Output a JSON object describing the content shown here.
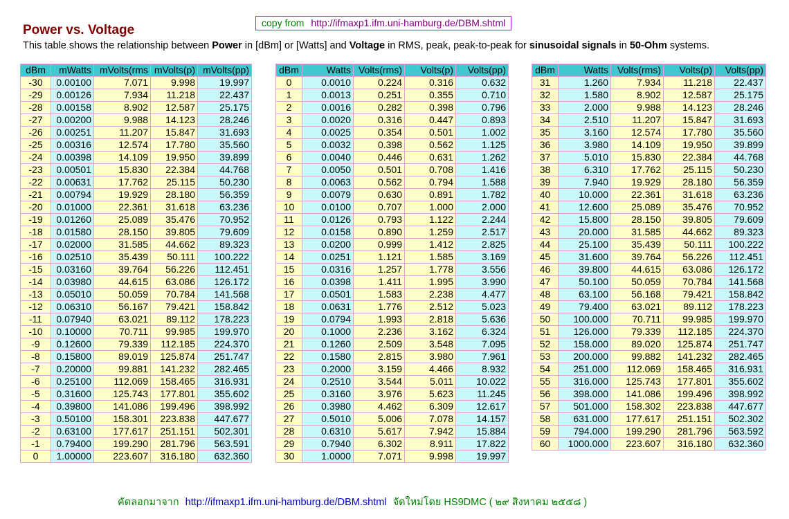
{
  "copy_box": {
    "label": "copy from",
    "url": "http://ifmaxp1.ifm.uni-hamburg.de/DBM.shtml"
  },
  "title": "Power vs. Voltage",
  "description": {
    "p1": "This table shows the relationship between ",
    "b1": "Power",
    "p2": " in [dBm] or [Watts] and ",
    "b2": "Voltage",
    "p3": " in RMS, peak, peak-to-peak for ",
    "b3": "sinusoidal signals",
    "p4": " in ",
    "b4": "50-Ohm",
    "p5": " systems."
  },
  "tables": [
    {
      "headers": [
        "dBm",
        "mWatts",
        "mVolts(rms",
        "mVolts(p)",
        "mVolts(pp)"
      ],
      "rows": [
        [
          "-30",
          "0.00100",
          "7.071",
          "9.998",
          "19.997"
        ],
        [
          "-29",
          "0.00126",
          "7.934",
          "11.218",
          "22.437"
        ],
        [
          "-28",
          "0.00158",
          "8.902",
          "12.587",
          "25.175"
        ],
        [
          "-27",
          "0.00200",
          "9.988",
          "14.123",
          "28.246"
        ],
        [
          "-26",
          "0.00251",
          "11.207",
          "15.847",
          "31.693"
        ],
        [
          "-25",
          "0.00316",
          "12.574",
          "17.780",
          "35.560"
        ],
        [
          "-24",
          "0.00398",
          "14.109",
          "19.950",
          "39.899"
        ],
        [
          "-23",
          "0.00501",
          "15.830",
          "22.384",
          "44.768"
        ],
        [
          "-22",
          "0.00631",
          "17.762",
          "25.115",
          "50.230"
        ],
        [
          "-21",
          "0.00794",
          "19.929",
          "28.180",
          "56.359"
        ],
        [
          "-20",
          "0.01000",
          "22.361",
          "31.618",
          "63.236"
        ],
        [
          "-19",
          "0.01260",
          "25.089",
          "35.476",
          "70.952"
        ],
        [
          "-18",
          "0.01580",
          "28.150",
          "39.805",
          "79.609"
        ],
        [
          "-17",
          "0.02000",
          "31.585",
          "44.662",
          "89.323"
        ],
        [
          "-16",
          "0.02510",
          "35.439",
          "50.111",
          "100.222"
        ],
        [
          "-15",
          "0.03160",
          "39.764",
          "56.226",
          "112.451"
        ],
        [
          "-14",
          "0.03980",
          "44.615",
          "63.086",
          "126.172"
        ],
        [
          "-13",
          "0.05010",
          "50.059",
          "70.784",
          "141.568"
        ],
        [
          "-12",
          "0.06310",
          "56.167",
          "79.421",
          "158.842"
        ],
        [
          "-11",
          "0.07940",
          "63.021",
          "89.112",
          "178.223"
        ],
        [
          "-10",
          "0.10000",
          "70.711",
          "99.985",
          "199.970"
        ],
        [
          "-9",
          "0.12600",
          "79.339",
          "112.185",
          "224.370"
        ],
        [
          "-8",
          "0.15800",
          "89.019",
          "125.874",
          "251.747"
        ],
        [
          "-7",
          "0.20000",
          "99.881",
          "141.232",
          "282.465"
        ],
        [
          "-6",
          "0.25100",
          "112.069",
          "158.465",
          "316.931"
        ],
        [
          "-5",
          "0.31600",
          "125.743",
          "177.801",
          "355.602"
        ],
        [
          "-4",
          "0.39800",
          "141.086",
          "199.496",
          "398.992"
        ],
        [
          "-3",
          "0.50100",
          "158.301",
          "223.838",
          "447.677"
        ],
        [
          "-2",
          "0.63100",
          "177.617",
          "251.151",
          "502.301"
        ],
        [
          "-1",
          "0.79400",
          "199.290",
          "281.796",
          "563.591"
        ],
        [
          "0",
          "1.00000",
          "223.607",
          "316.180",
          "632.360"
        ]
      ]
    },
    {
      "headers": [
        "dBm",
        "Watts",
        "Volts(rms)",
        "Volts(p)",
        "Volts(pp)"
      ],
      "rows": [
        [
          "0",
          "0.0010",
          "0.224",
          "0.316",
          "0.632"
        ],
        [
          "1",
          "0.0013",
          "0.251",
          "0.355",
          "0.710"
        ],
        [
          "2",
          "0.0016",
          "0.282",
          "0.398",
          "0.796"
        ],
        [
          "3",
          "0.0020",
          "0.316",
          "0.447",
          "0.893"
        ],
        [
          "4",
          "0.0025",
          "0.354",
          "0.501",
          "1.002"
        ],
        [
          "5",
          "0.0032",
          "0.398",
          "0.562",
          "1.125"
        ],
        [
          "6",
          "0.0040",
          "0.446",
          "0.631",
          "1.262"
        ],
        [
          "7",
          "0.0050",
          "0.501",
          "0.708",
          "1.416"
        ],
        [
          "8",
          "0.0063",
          "0.562",
          "0.794",
          "1.588"
        ],
        [
          "9",
          "0.0079",
          "0.630",
          "0.891",
          "1.782"
        ],
        [
          "10",
          "0.0100",
          "0.707",
          "1.000",
          "2.000"
        ],
        [
          "11",
          "0.0126",
          "0.793",
          "1.122",
          "2.244"
        ],
        [
          "12",
          "0.0158",
          "0.890",
          "1.259",
          "2.517"
        ],
        [
          "13",
          "0.0200",
          "0.999",
          "1.412",
          "2.825"
        ],
        [
          "14",
          "0.0251",
          "1.121",
          "1.585",
          "3.169"
        ],
        [
          "15",
          "0.0316",
          "1.257",
          "1.778",
          "3.556"
        ],
        [
          "16",
          "0.0398",
          "1.411",
          "1.995",
          "3.990"
        ],
        [
          "17",
          "0.0501",
          "1.583",
          "2.238",
          "4.477"
        ],
        [
          "18",
          "0.0631",
          "1.776",
          "2.512",
          "5.023"
        ],
        [
          "19",
          "0.0794",
          "1.993",
          "2.818",
          "5.636"
        ],
        [
          "20",
          "0.1000",
          "2.236",
          "3.162",
          "6.324"
        ],
        [
          "21",
          "0.1260",
          "2.509",
          "3.548",
          "7.095"
        ],
        [
          "22",
          "0.1580",
          "2.815",
          "3.980",
          "7.961"
        ],
        [
          "23",
          "0.2000",
          "3.159",
          "4.466",
          "8.932"
        ],
        [
          "24",
          "0.2510",
          "3.544",
          "5.011",
          "10.022"
        ],
        [
          "25",
          "0.3160",
          "3.976",
          "5.623",
          "11.245"
        ],
        [
          "26",
          "0.3980",
          "4.462",
          "6.309",
          "12.617"
        ],
        [
          "27",
          "0.5010",
          "5.006",
          "7.078",
          "14.157"
        ],
        [
          "28",
          "0.6310",
          "5.617",
          "7.942",
          "15.884"
        ],
        [
          "29",
          "0.7940",
          "6.302",
          "8.911",
          "17.822"
        ],
        [
          "30",
          "1.0000",
          "7.071",
          "9.998",
          "19.997"
        ]
      ]
    },
    {
      "headers": [
        "dBm",
        "Watts",
        "Volts(rms)",
        "Volts(p)",
        "Volts(pp)"
      ],
      "rows": [
        [
          "31",
          "1.260",
          "7.934",
          "11.218",
          "22.437"
        ],
        [
          "32",
          "1.580",
          "8.902",
          "12.587",
          "25.175"
        ],
        [
          "33",
          "2.000",
          "9.988",
          "14.123",
          "28.246"
        ],
        [
          "34",
          "2.510",
          "11.207",
          "15.847",
          "31.693"
        ],
        [
          "35",
          "3.160",
          "12.574",
          "17.780",
          "35.560"
        ],
        [
          "36",
          "3.980",
          "14.109",
          "19.950",
          "39.899"
        ],
        [
          "37",
          "5.010",
          "15.830",
          "22.384",
          "44.768"
        ],
        [
          "38",
          "6.310",
          "17.762",
          "25.115",
          "50.230"
        ],
        [
          "39",
          "7.940",
          "19.929",
          "28.180",
          "56.359"
        ],
        [
          "40",
          "10.000",
          "22.361",
          "31.618",
          "63.236"
        ],
        [
          "41",
          "12.600",
          "25.089",
          "35.476",
          "70.952"
        ],
        [
          "42",
          "15.800",
          "28.150",
          "39.805",
          "79.609"
        ],
        [
          "43",
          "20.000",
          "31.585",
          "44.662",
          "89.323"
        ],
        [
          "44",
          "25.100",
          "35.439",
          "50.111",
          "100.222"
        ],
        [
          "45",
          "31.600",
          "39.764",
          "56.226",
          "112.451"
        ],
        [
          "46",
          "39.800",
          "44.615",
          "63.086",
          "126.172"
        ],
        [
          "47",
          "50.100",
          "50.059",
          "70.784",
          "141.568"
        ],
        [
          "48",
          "63.100",
          "56.168",
          "79.421",
          "158.842"
        ],
        [
          "49",
          "79.400",
          "63.021",
          "89.112",
          "178.223"
        ],
        [
          "50",
          "100.000",
          "70.711",
          "99.985",
          "199.970"
        ],
        [
          "51",
          "126.000",
          "79.339",
          "112.185",
          "224.370"
        ],
        [
          "52",
          "158.000",
          "89.020",
          "125.874",
          "251.747"
        ],
        [
          "53",
          "200.000",
          "99.882",
          "141.232",
          "282.465"
        ],
        [
          "54",
          "251.000",
          "112.069",
          "158.465",
          "316.931"
        ],
        [
          "55",
          "316.000",
          "125.743",
          "177.801",
          "355.602"
        ],
        [
          "56",
          "398.000",
          "141.086",
          "199.496",
          "398.992"
        ],
        [
          "57",
          "501.000",
          "158.302",
          "223.838",
          "447.677"
        ],
        [
          "58",
          "631.000",
          "177.617",
          "251.151",
          "502.302"
        ],
        [
          "59",
          "794.000",
          "199.290",
          "281.796",
          "563.592"
        ],
        [
          "60",
          "1000.000",
          "223.607",
          "316.180",
          "632.360"
        ]
      ]
    }
  ],
  "footer": {
    "prefix": "คัดลอกมาจาก",
    "url": "http://ifmaxp1.ifm.uni-hamburg.de/DBM.shtml",
    "suffix": "จัดใหม่โดย HS9DMC  ( ๒๙ สิงหาคม ๒๕๕๘ )"
  },
  "colors": {
    "title": "#800000",
    "header_bg": "#40c8d0",
    "cell_yellow": "#ffffc8",
    "cell_cyan": "#c8f8f8",
    "cell_border": "#e0a0d0"
  }
}
